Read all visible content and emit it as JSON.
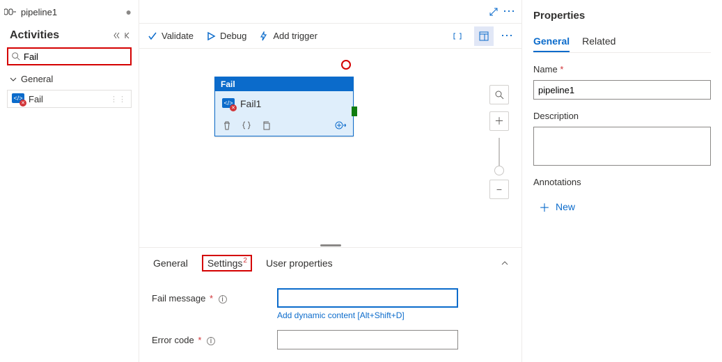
{
  "tab": {
    "title": "pipeline1"
  },
  "activities": {
    "header": "Activities",
    "search_value": "Fail",
    "group": "General",
    "items": [
      {
        "label": "Fail"
      }
    ]
  },
  "toolbar": {
    "validate": "Validate",
    "debug": "Debug",
    "add_trigger": "Add trigger"
  },
  "canvas": {
    "node_type": "Fail",
    "node_name": "Fail1"
  },
  "bottom_tabs": {
    "general": "General",
    "settings": "Settings",
    "settings_badge": "2",
    "user_properties": "User properties"
  },
  "settings_form": {
    "fail_message_label": "Fail message",
    "fail_message_value": "",
    "dynamic_link": "Add dynamic content [Alt+Shift+D]",
    "error_code_label": "Error code",
    "error_code_value": ""
  },
  "properties": {
    "title": "Properties",
    "tab_general": "General",
    "tab_related": "Related",
    "name_label": "Name",
    "name_value": "pipeline1",
    "description_label": "Description",
    "description_value": "",
    "annotations_label": "Annotations",
    "new_label": "New"
  }
}
